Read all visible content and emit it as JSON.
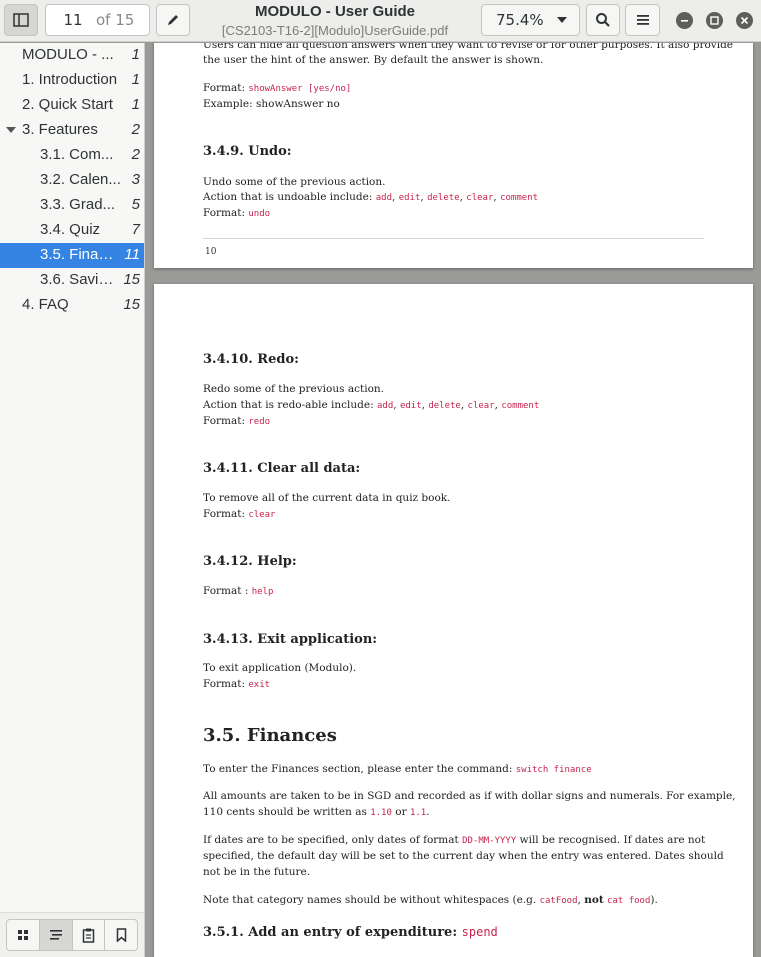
{
  "header": {
    "page_current": "11",
    "page_of": "of 15",
    "title": "MODULO - User Guide",
    "filename": "[CS2103-T16-2][Modulo]UserGuide.pdf",
    "zoom": "75.4%"
  },
  "outline": [
    {
      "label": "MODULO - ...",
      "page": "1"
    },
    {
      "label": "1. Introduction",
      "page": "1"
    },
    {
      "label": "2. Quick Start",
      "page": "1"
    },
    {
      "label": "3. Features",
      "page": "2"
    },
    {
      "label": "3.1. Com...",
      "page": "2"
    },
    {
      "label": "3.2. Calen...",
      "page": "3"
    },
    {
      "label": "3.3. Grad...",
      "page": "5"
    },
    {
      "label": "3.4. Quiz",
      "page": "7"
    },
    {
      "label": "3.5. Finan...",
      "page": "11"
    },
    {
      "label": "3.6. Savin...",
      "page": "15"
    },
    {
      "label": "4. FAQ",
      "page": "15"
    }
  ],
  "page1": {
    "line1": "Users can hide all question answers when they want to revise or for other purposes. It also provide",
    "line2": "the user the hint of the answer. By default the answer is shown.",
    "format_label": "Format: ",
    "format_code": "showAnswer [yes/no]",
    "example": "Example: showAnswer no",
    "undo_heading": "3.4.9. Undo:",
    "undo_desc": "Undo some of the previous action.",
    "undo_actions_label": "Action that is undoable include: ",
    "actions": [
      "add",
      "edit",
      "delete",
      "clear",
      "comment"
    ],
    "undo_format_label": "Format: ",
    "undo_format_code": "undo",
    "page_number": "10"
  },
  "page2": {
    "redo_heading": "3.4.10. Redo:",
    "redo_desc": "Redo some of the previous action.",
    "redo_actions_label": "Action that is redo-able include: ",
    "redo_format_label": "Format: ",
    "redo_format_code": "redo",
    "clear_heading": "3.4.11. Clear all data:",
    "clear_desc": "To remove all of the current data in quiz book.",
    "clear_format_label": "Format: ",
    "clear_format_code": "clear",
    "help_heading": "3.4.12. Help:",
    "help_format_label": "Format : ",
    "help_format_code": "help",
    "exit_heading": "3.4.13. Exit application:",
    "exit_desc": "To exit application (Modulo).",
    "exit_format_label": "Format: ",
    "exit_format_code": "exit",
    "finances_heading": "3.5. Finances",
    "fin_enter_text": "To enter the Finances section, please enter the command: ",
    "fin_enter_code": "switch finance",
    "fin_amounts_1": "All amounts are taken to be in SGD and recorded as if with dollar signs and numerals. For example,",
    "fin_amounts_2a": "110 cents should be written as ",
    "fin_amounts_code1": "1.10",
    "fin_amounts_or": " or ",
    "fin_amounts_code2": "1.1",
    "fin_amounts_end": ".",
    "fin_dates_1a": "If dates are to be specified, only dates of format ",
    "fin_dates_code": "DD-MM-YYYY",
    "fin_dates_1b": " will be recognised. If dates are not",
    "fin_dates_2": "specified, the default day will be set to the current day when the entry was entered. Dates should",
    "fin_dates_3": "not be in the future.",
    "fin_note_a": "Note that category names should be without whitespaces (e.g. ",
    "fin_note_code1": "catFood",
    "fin_note_b": ", ",
    "fin_note_not": "not",
    "fin_note_c": " ",
    "fin_note_code2": "cat food",
    "fin_note_d": ").",
    "spend_heading": "3.5.1. Add an entry of expenditure: ",
    "spend_code": "spend"
  }
}
